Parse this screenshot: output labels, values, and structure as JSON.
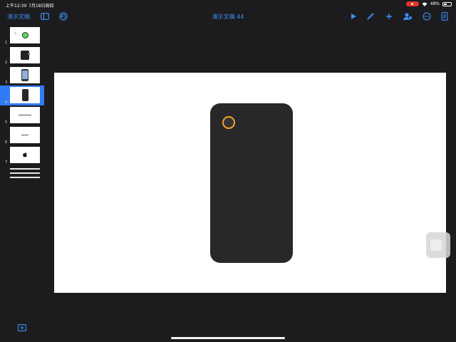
{
  "status_bar": {
    "time": "上午12:39",
    "date": "7月18日周四",
    "battery": "48%",
    "battery_level": 0.48
  },
  "toolbar": {
    "documents_label": "演示文稿",
    "title": "演示文稿 44",
    "icons": [
      "sidebar-icon",
      "undo-icon",
      "play-icon",
      "brush-icon",
      "plus-icon",
      "collaborate-icon",
      "more-icon",
      "document-icon"
    ]
  },
  "navigator": {
    "selected": 4,
    "slides": [
      {
        "number": "1",
        "content": "green-circle"
      },
      {
        "number": "2",
        "content": "dark-device"
      },
      {
        "number": "3",
        "content": "phone-photo"
      },
      {
        "number": "4",
        "content": "phone-back"
      },
      {
        "number": "5",
        "content": "small-text"
      },
      {
        "number": "6",
        "content": "small-text"
      },
      {
        "number": "7",
        "content": "apple-logo"
      }
    ]
  },
  "colors": {
    "accent": "#3a8ff5",
    "selection": "#2f7cf6",
    "lens_ring": "#f5a623",
    "phone_body": "#28282a"
  }
}
